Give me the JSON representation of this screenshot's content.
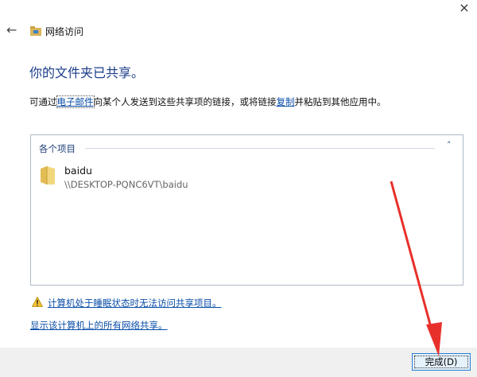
{
  "window": {
    "title": "网络访问",
    "close_glyph": "×",
    "back_glyph": "←"
  },
  "main": {
    "heading": "你的文件夹已共享。",
    "desc_prefix": "可通过",
    "email_link": "电子邮件",
    "desc_middle": "向某个人发送到这些共享项的链接，或将链接",
    "copy_link": "复制",
    "desc_suffix": "并粘贴到其他应用中。"
  },
  "items_box": {
    "group_label": "各个项目",
    "collapse_glyph": "˄",
    "items": [
      {
        "name": "baidu",
        "path": "\\\\DESKTOP-PQNC6VT\\baidu"
      }
    ]
  },
  "links": {
    "sleep_warning": "计算机处于睡眠状态时无法访问共享项目。",
    "show_all": "显示该计算机上的所有网络共享。"
  },
  "footer": {
    "finish_label": "完成(D)"
  },
  "colors": {
    "heading": "#1a3c8a",
    "link": "#0b4ea8",
    "annotation_arrow": "#e8302a"
  },
  "icons": {
    "network": "network-folder-icon",
    "folder": "folder-icon",
    "warning": "warning-icon"
  }
}
